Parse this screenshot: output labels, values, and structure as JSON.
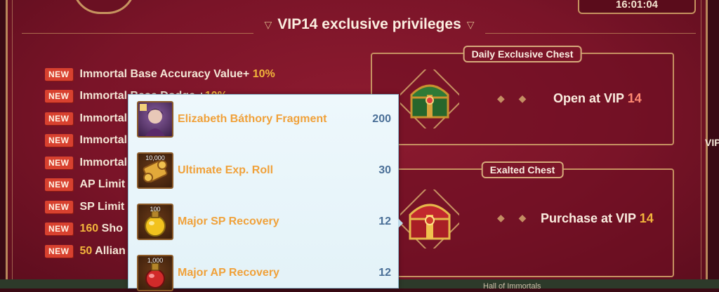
{
  "timer": "16:01:04",
  "title": "VIP14 exclusive privileges",
  "privileges": [
    {
      "badge": "NEW",
      "pre": "",
      "text": "Immortal Base Accuracy Value+ ",
      "hl": "10%"
    },
    {
      "badge": "NEW",
      "pre": "",
      "text": "Immortal Base Dodge +",
      "hl": "10%"
    },
    {
      "badge": "NEW",
      "pre": "",
      "text": "Immortal",
      "hl": ""
    },
    {
      "badge": "NEW",
      "pre": "",
      "text": "Immortal",
      "hl": ""
    },
    {
      "badge": "NEW",
      "pre": "",
      "text": "Immortal",
      "hl": ""
    },
    {
      "badge": "NEW",
      "pre": "",
      "text": "AP Limit",
      "hl": ""
    },
    {
      "badge": "NEW",
      "pre": "",
      "text": "SP Limit",
      "hl": ""
    },
    {
      "badge": "NEW",
      "pre": "160",
      "text": " Sho",
      "hl": ""
    },
    {
      "badge": "NEW",
      "pre": "50",
      "text": " Allian",
      "hl": ""
    }
  ],
  "daily_chest": {
    "tab": "Daily Exclusive Chest",
    "caption": "Open at VIP ",
    "level": "14"
  },
  "exalted_chest": {
    "tab": "Exalted Chest",
    "caption": "Purchase at VIP ",
    "level": "14"
  },
  "side_right": "VIP",
  "bottom_label": "Hall of Immortals",
  "tooltip_items": [
    {
      "name": "Elizabeth Báthory Fragment",
      "count": "200",
      "qty": "",
      "icon": "puzzle-portrait-icon"
    },
    {
      "name": "Ultimate Exp. Roll",
      "count": "30",
      "qty": "10,000",
      "icon": "scroll-icon"
    },
    {
      "name": "Major SP Recovery",
      "count": "12",
      "qty": "100",
      "icon": "yellow-potion-icon"
    },
    {
      "name": "Major AP Recovery",
      "count": "12",
      "qty": "1,000",
      "icon": "red-potion-icon"
    }
  ],
  "colors": {
    "accent_gold": "#f2b53b",
    "badge_red": "#d8412f",
    "item_orange": "#f0a13a",
    "count_blue": "#4a6f97"
  }
}
